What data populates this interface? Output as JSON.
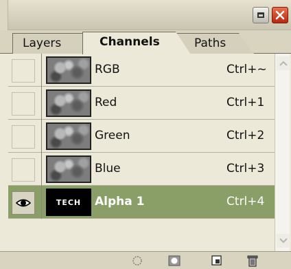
{
  "tabs": [
    {
      "label": "Layers"
    },
    {
      "label": "Channels"
    },
    {
      "label": "Paths"
    }
  ],
  "channels": [
    {
      "name": "RGB",
      "shortcut": "Ctrl+~",
      "visible": false
    },
    {
      "name": "Red",
      "shortcut": "Ctrl+1",
      "visible": false
    },
    {
      "name": "Green",
      "shortcut": "Ctrl+2",
      "visible": false
    },
    {
      "name": "Blue",
      "shortcut": "Ctrl+3",
      "visible": false
    },
    {
      "name": "Alpha 1",
      "shortcut": "Ctrl+4",
      "visible": true,
      "thumb_text": "TECH",
      "selected": true
    }
  ],
  "colors": {
    "panel_bg": "#ece9d8",
    "selected_row": "#8a9e68",
    "close_button": "#c8381a",
    "flyout_button": "#5a9a1a"
  },
  "icons": {
    "titlebar": [
      "minimize-icon",
      "close-icon"
    ],
    "menu": "panel-menu-arrow-icon",
    "visibility": "eye-icon",
    "footer": [
      "load-selection-icon",
      "save-selection-icon",
      "new-channel-icon",
      "delete-channel-icon"
    ]
  }
}
